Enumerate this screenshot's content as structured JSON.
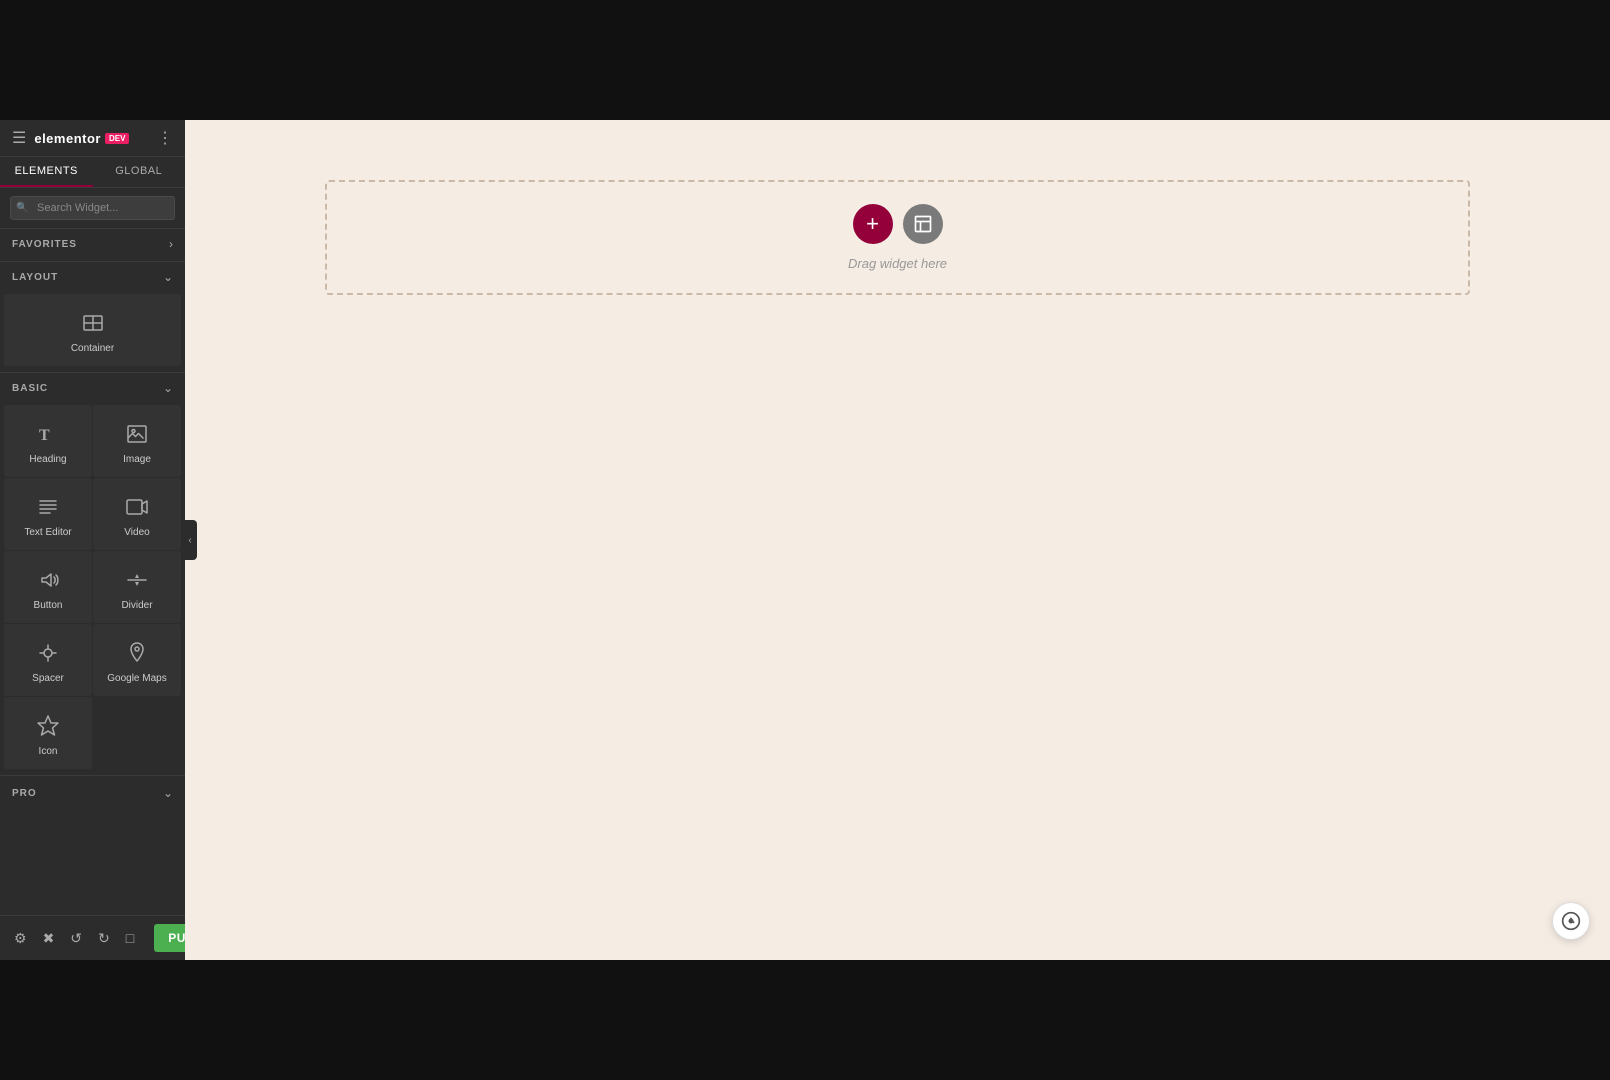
{
  "topBar": {
    "height": 120
  },
  "sidebar": {
    "logo": "elementor",
    "badge": "DEV",
    "tabs": [
      {
        "id": "elements",
        "label": "ELEMENTS",
        "active": true
      },
      {
        "id": "global",
        "label": "GLOBAL",
        "active": false
      }
    ],
    "search": {
      "placeholder": "Search Widget...",
      "value": ""
    },
    "sections": {
      "favorites": {
        "label": "FAVORITES",
        "arrowIcon": "chevron-right"
      },
      "layout": {
        "label": "LAYOUT",
        "arrowIcon": "chevron-down"
      },
      "basic": {
        "label": "BASIC",
        "arrowIcon": "chevron-down"
      },
      "pro": {
        "label": "PRO",
        "arrowIcon": "chevron-down"
      }
    },
    "layoutWidgets": [
      {
        "id": "container",
        "label": "Container",
        "icon": "container-icon"
      }
    ],
    "basicWidgets": [
      {
        "id": "heading",
        "label": "Heading",
        "icon": "heading-icon"
      },
      {
        "id": "image",
        "label": "Image",
        "icon": "image-icon"
      },
      {
        "id": "text-editor",
        "label": "Text Editor",
        "icon": "text-editor-icon"
      },
      {
        "id": "video",
        "label": "Video",
        "icon": "video-icon"
      },
      {
        "id": "button",
        "label": "Button",
        "icon": "button-icon"
      },
      {
        "id": "divider",
        "label": "Divider",
        "icon": "divider-icon"
      },
      {
        "id": "spacer",
        "label": "Spacer",
        "icon": "spacer-icon"
      },
      {
        "id": "google-maps",
        "label": "Google Maps",
        "icon": "maps-icon"
      },
      {
        "id": "icon",
        "label": "Icon",
        "icon": "icon-icon"
      }
    ]
  },
  "toolbar": {
    "settings_icon": "settings",
    "history_icon": "history",
    "undo_icon": "undo",
    "redo_icon": "redo",
    "responsive_icon": "responsive",
    "publish_label": "PUBLISH",
    "arrow_icon": "chevron-down"
  },
  "canvas": {
    "background": "#f5ece4",
    "dropzone": {
      "hint": "Drag widget here"
    },
    "add_btn_label": "+",
    "lib_btn_label": "⊡"
  }
}
